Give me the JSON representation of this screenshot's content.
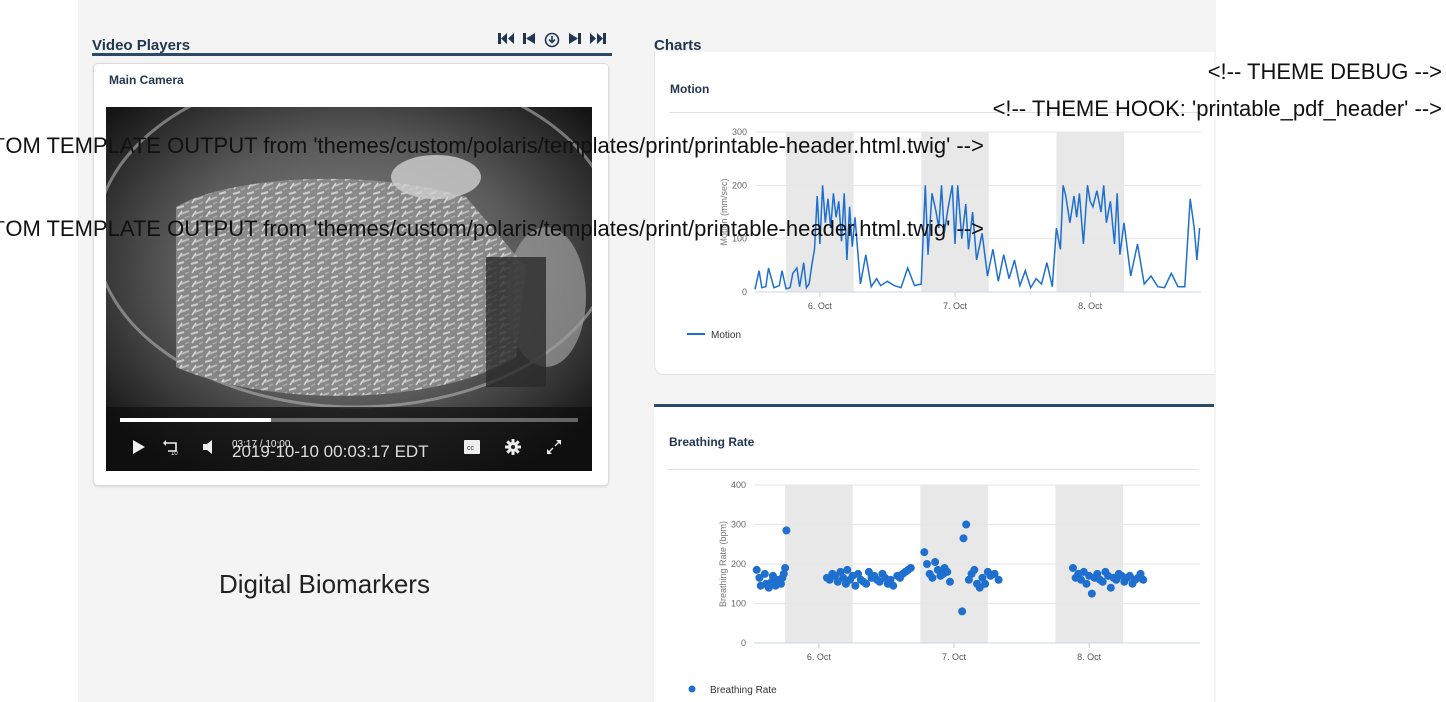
{
  "video_players": {
    "title": "Video Players",
    "camera_title": "Main Camera",
    "time": "03:17 / 10:00",
    "timestamp_overlay": "2019-10-10 00:03:17 EDT",
    "progress": 0.33,
    "transport_icons": [
      "skip-to-start-icon",
      "step-back-icon",
      "download-icon",
      "step-forward-icon",
      "skip-to-end-icon"
    ]
  },
  "brand_text": "Digital Biomarkers",
  "charts": {
    "title": "Charts",
    "motion": {
      "title": "Motion",
      "ylabel": "Motion (mm/sec)",
      "legend": "Motion"
    },
    "breathing": {
      "title": "Breathing Rate",
      "ylabel": "Breathing Rate (bpm)",
      "legend": "Breathing Rate"
    }
  },
  "debug_comments": {
    "theme_debug": "<!-- THEME DEBUG -->",
    "theme_hook": "<!-- THEME HOOK: 'printable_pdf_header' -->",
    "template_output_1": "ˉOM TEMPLATE OUTPUT from 'themes/custom/polaris/templates/print/printable-header.html.twig' -->",
    "template_output_2": "ˉOM TEMPLATE OUTPUT from 'themes/custom/polaris/templates/print/printable-header.html.twig' -->"
  },
  "colors": {
    "accent": "#2a4a68",
    "series": "#1f6fcf",
    "band": "#e8e8e8"
  },
  "chart_data": [
    {
      "type": "line",
      "title": "Motion",
      "ylabel": "Motion (mm/sec)",
      "ylim": [
        0,
        300
      ],
      "yticks": [
        0,
        100,
        200,
        300
      ],
      "xlim": [
        5.52,
        8.82
      ],
      "xticks": [
        {
          "v": 6,
          "label": "6. Oct"
        },
        {
          "v": 7,
          "label": "7. Oct"
        },
        {
          "v": 8,
          "label": "8. Oct"
        }
      ],
      "night_bands": [
        [
          5.75,
          6.25
        ],
        [
          6.75,
          7.25
        ],
        [
          7.75,
          8.25
        ]
      ],
      "series": [
        {
          "name": "Motion",
          "x": [
            5.52,
            5.55,
            5.57,
            5.6,
            5.62,
            5.66,
            5.7,
            5.72,
            5.75,
            5.78,
            5.8,
            5.83,
            5.85,
            5.88,
            5.9,
            5.92,
            5.94,
            5.96,
            5.98,
            6.0,
            6.02,
            6.04,
            6.06,
            6.08,
            6.1,
            6.12,
            6.14,
            6.16,
            6.18,
            6.2,
            6.22,
            6.24,
            6.26,
            6.3,
            6.34,
            6.38,
            6.42,
            6.45,
            6.5,
            6.55,
            6.6,
            6.65,
            6.7,
            6.75,
            6.78,
            6.8,
            6.83,
            6.86,
            6.88,
            6.9,
            6.92,
            6.95,
            6.98,
            7.0,
            7.02,
            7.05,
            7.08,
            7.1,
            7.13,
            7.16,
            7.2,
            7.24,
            7.28,
            7.32,
            7.36,
            7.4,
            7.44,
            7.48,
            7.52,
            7.56,
            7.6,
            7.64,
            7.68,
            7.72,
            7.75,
            7.78,
            7.8,
            7.82,
            7.85,
            7.88,
            7.9,
            7.92,
            7.95,
            7.98,
            8.0,
            8.02,
            8.05,
            8.08,
            8.1,
            8.12,
            8.15,
            8.18,
            8.2,
            8.22,
            8.25,
            8.3,
            8.35,
            8.4,
            8.45,
            8.5,
            8.55,
            8.6,
            8.65,
            8.7,
            8.74,
            8.77,
            8.79,
            8.81
          ],
          "y": [
            5,
            40,
            8,
            10,
            45,
            8,
            12,
            40,
            6,
            8,
            35,
            45,
            10,
            55,
            8,
            15,
            50,
            80,
            180,
            90,
            200,
            130,
            175,
            120,
            185,
            140,
            170,
            95,
            185,
            60,
            160,
            85,
            140,
            15,
            70,
            10,
            25,
            12,
            20,
            12,
            8,
            45,
            12,
            15,
            200,
            70,
            185,
            150,
            120,
            200,
            110,
            160,
            200,
            90,
            200,
            100,
            165,
            80,
            150,
            60,
            110,
            30,
            80,
            20,
            70,
            25,
            60,
            12,
            40,
            8,
            25,
            15,
            55,
            10,
            120,
            80,
            200,
            180,
            130,
            180,
            140,
            185,
            90,
            200,
            170,
            160,
            190,
            150,
            200,
            130,
            170,
            90,
            185,
            70,
            130,
            30,
            90,
            15,
            30,
            10,
            8,
            35,
            10,
            10,
            175,
            120,
            60,
            120
          ]
        }
      ]
    },
    {
      "type": "scatter",
      "title": "Breathing Rate",
      "ylabel": "Breathing Rate (bpm)",
      "ylim": [
        0,
        400
      ],
      "yticks": [
        0,
        100,
        200,
        300,
        400
      ],
      "xlim": [
        5.52,
        8.82
      ],
      "xticks": [
        {
          "v": 6,
          "label": "6. Oct"
        },
        {
          "v": 7,
          "label": "7. Oct"
        },
        {
          "v": 8,
          "label": "8. Oct"
        }
      ],
      "night_bands": [
        [
          5.75,
          6.25
        ],
        [
          6.75,
          7.25
        ],
        [
          7.75,
          8.25
        ]
      ],
      "series": [
        {
          "name": "Breathing Rate",
          "x": [
            5.54,
            5.56,
            5.57,
            5.6,
            5.61,
            5.63,
            5.65,
            5.66,
            5.68,
            5.7,
            5.72,
            5.73,
            5.74,
            5.75,
            5.76,
            6.06,
            6.08,
            6.1,
            6.12,
            6.14,
            6.16,
            6.18,
            6.2,
            6.21,
            6.23,
            6.25,
            6.27,
            6.29,
            6.31,
            6.33,
            6.35,
            6.37,
            6.39,
            6.41,
            6.43,
            6.45,
            6.47,
            6.49,
            6.51,
            6.53,
            6.55,
            6.58,
            6.6,
            6.62,
            6.64,
            6.66,
            6.68,
            6.78,
            6.8,
            6.82,
            6.84,
            6.86,
            6.88,
            6.9,
            6.92,
            6.93,
            6.95,
            6.97,
            7.06,
            7.07,
            7.09,
            7.11,
            7.13,
            7.15,
            7.17,
            7.19,
            7.21,
            7.23,
            7.25,
            7.27,
            7.3,
            7.33,
            7.88,
            7.9,
            7.92,
            7.94,
            7.96,
            7.98,
            8.0,
            8.02,
            8.04,
            8.06,
            8.08,
            8.1,
            8.12,
            8.14,
            8.16,
            8.18,
            8.2,
            8.22,
            8.24,
            8.26,
            8.28,
            8.3,
            8.32,
            8.34,
            8.36,
            8.38,
            8.4
          ],
          "y": [
            185,
            165,
            145,
            175,
            150,
            140,
            155,
            170,
            145,
            160,
            150,
            165,
            175,
            190,
            285,
            165,
            160,
            175,
            170,
            155,
            180,
            165,
            150,
            185,
            160,
            170,
            145,
            175,
            160,
            155,
            150,
            180,
            165,
            170,
            160,
            155,
            175,
            165,
            150,
            160,
            145,
            170,
            165,
            175,
            180,
            185,
            190,
            230,
            200,
            175,
            165,
            205,
            185,
            170,
            175,
            190,
            180,
            155,
            80,
            265,
            300,
            160,
            175,
            185,
            150,
            140,
            165,
            150,
            180,
            170,
            175,
            160,
            190,
            165,
            175,
            160,
            180,
            150,
            170,
            125,
            165,
            175,
            160,
            155,
            180,
            170,
            140,
            165,
            160,
            175,
            170,
            155,
            165,
            170,
            150,
            160,
            165,
            175,
            160
          ]
        }
      ]
    }
  ]
}
